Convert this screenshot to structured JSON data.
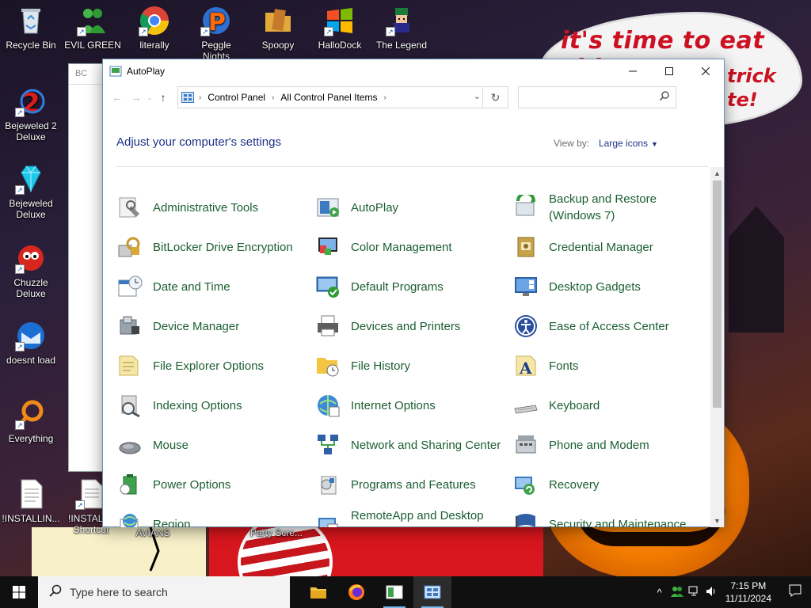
{
  "wallpaper": {
    "caption_line1": "it's time to eat shit",
    "caption_line2": "trick",
    "caption_line3": "te!"
  },
  "desktop_icons": [
    {
      "label": "Recycle Bin",
      "icon": "recycle-bin-icon"
    },
    {
      "label": "EVIL GREEN",
      "icon": "green-people-icon"
    },
    {
      "label": "literally",
      "icon": "chrome-icon"
    },
    {
      "label": "Peggle Nights",
      "icon": "peggle-icon"
    },
    {
      "label": "Spoopy",
      "icon": "folder-icon"
    },
    {
      "label": "HalloDock",
      "icon": "windows-flag-icon"
    },
    {
      "label": "The Legend",
      "icon": "pixel-hero-icon"
    },
    {
      "label": "Bejeweled 2 Deluxe",
      "icon": "bejeweled2-icon"
    },
    {
      "label": "Bejeweled Deluxe",
      "icon": "diamond-icon"
    },
    {
      "label": "Chuzzle Deluxe",
      "icon": "chuzzle-icon"
    },
    {
      "label": "doesnt load",
      "icon": "thunderbird-icon"
    },
    {
      "label": "Everything",
      "icon": "everything-icon"
    },
    {
      "label": "!INSTALLIN...",
      "icon": "document-icon"
    },
    {
      "label": "!INSTALL - Shortcut",
      "icon": "document-icon"
    },
    {
      "label": "AVIANS",
      "icon": "avians-icon"
    },
    {
      "label": "Party Scre...",
      "icon": "party-icon"
    }
  ],
  "background_window": {
    "title": "BC"
  },
  "window": {
    "title": "AutoPlay",
    "breadcrumb": [
      "Control Panel",
      "All Control Panel Items"
    ],
    "search_placeholder": "",
    "heading": "Adjust your computer's settings",
    "view_by_label": "View by:",
    "view_by_value": "Large icons"
  },
  "items": [
    {
      "label": "Administrative Tools",
      "icon": "admin-tools-icon"
    },
    {
      "label": "AutoPlay",
      "icon": "autoplay-icon"
    },
    {
      "label": "Backup and Restore (Windows 7)",
      "icon": "backup-restore-icon"
    },
    {
      "label": "BitLocker Drive Encryption",
      "icon": "bitlocker-icon"
    },
    {
      "label": "Color Management",
      "icon": "color-management-icon"
    },
    {
      "label": "Credential Manager",
      "icon": "credential-manager-icon"
    },
    {
      "label": "Date and Time",
      "icon": "date-time-icon"
    },
    {
      "label": "Default Programs",
      "icon": "default-programs-icon"
    },
    {
      "label": "Desktop Gadgets",
      "icon": "desktop-gadgets-icon"
    },
    {
      "label": "Device Manager",
      "icon": "device-manager-icon"
    },
    {
      "label": "Devices and Printers",
      "icon": "printer-icon"
    },
    {
      "label": "Ease of Access Center",
      "icon": "ease-of-access-icon"
    },
    {
      "label": "File Explorer Options",
      "icon": "folder-options-icon"
    },
    {
      "label": "File History",
      "icon": "file-history-icon"
    },
    {
      "label": "Fonts",
      "icon": "fonts-icon"
    },
    {
      "label": "Indexing Options",
      "icon": "indexing-icon"
    },
    {
      "label": "Internet Options",
      "icon": "internet-options-icon"
    },
    {
      "label": "Keyboard",
      "icon": "keyboard-icon"
    },
    {
      "label": "Mouse",
      "icon": "mouse-icon"
    },
    {
      "label": "Network and Sharing Center",
      "icon": "network-icon"
    },
    {
      "label": "Phone and Modem",
      "icon": "phone-modem-icon"
    },
    {
      "label": "Power Options",
      "icon": "power-options-icon"
    },
    {
      "label": "Programs and Features",
      "icon": "programs-features-icon"
    },
    {
      "label": "Recovery",
      "icon": "recovery-icon"
    },
    {
      "label": "Region",
      "icon": "region-icon"
    },
    {
      "label": "RemoteApp and Desktop Connections",
      "icon": "remoteapp-icon"
    },
    {
      "label": "Security and Maintenance",
      "icon": "security-flag-icon"
    }
  ],
  "taskbar": {
    "search_placeholder": "Type here to search",
    "time": "7:15 PM",
    "date": "11/11/2024"
  },
  "colors": {
    "link_green": "#1b5e32",
    "heading_blue": "#1e3287",
    "taskbar": "#101010"
  }
}
